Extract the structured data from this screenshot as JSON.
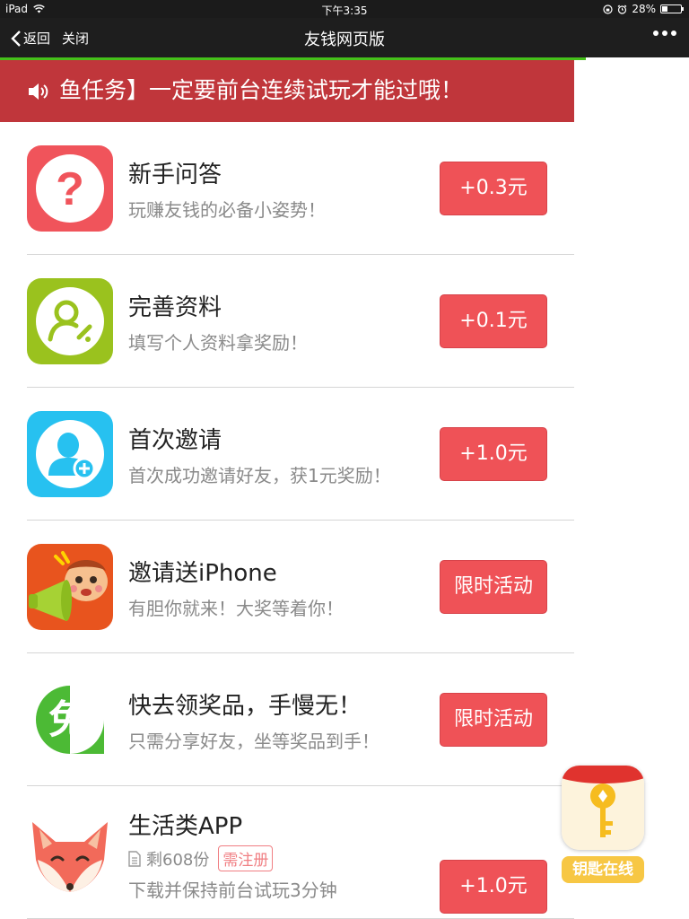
{
  "status_bar": {
    "device": "iPad",
    "time": "下午3:35",
    "battery": "28%",
    "battery_level": 0.28
  },
  "nav": {
    "back_label": "返回",
    "close_label": "关闭",
    "title": "友钱网页版",
    "page_load_progress": 0.85
  },
  "banner": {
    "text": "鱼任务】一定要前台连续试玩才能过哦！"
  },
  "tasks": [
    {
      "title": "新手问答",
      "subtitle": "玩赚友钱的必备小姿势！",
      "button": "+0.3元",
      "icon": "question-mark-icon",
      "icon_color": "#f0545b"
    },
    {
      "title": "完善资料",
      "subtitle": "填写个人资料拿奖励！",
      "button": "+0.1元",
      "icon": "profile-edit-icon",
      "icon_color": "#9ac21e"
    },
    {
      "title": "首次邀请",
      "subtitle": "首次成功邀请好友，获1元奖励！",
      "button": "+1.0元",
      "icon": "invite-user-icon",
      "icon_color": "#27c1f0"
    },
    {
      "title": "邀请送iPhone",
      "subtitle": "有胆你就来！大奖等着你！",
      "button": "限时活动",
      "icon": "mascot-megaphone-icon",
      "icon_color": "#e8541e"
    },
    {
      "title": "快去领奖品，手慢无！",
      "subtitle": "只需分享好友，坐等奖品到手！",
      "button": "限时活动",
      "icon": "free-icon",
      "icon_color": "#4cba35"
    },
    {
      "title": "生活类APP",
      "remaining": "剩608份",
      "tag": "需注册",
      "subtitle": "下载并保持前台试玩3分钟",
      "button": "+1.0元",
      "icon": "fox-icon",
      "icon_color": "#f26a5a"
    }
  ],
  "free_icon_char": "免",
  "key_badge": {
    "label": "钥匙在线"
  },
  "colors": {
    "accent_red": "#ef5257",
    "banner_red": "#c0363b",
    "progress_green": "#45c01a",
    "badge_yellow": "#f7c744"
  }
}
